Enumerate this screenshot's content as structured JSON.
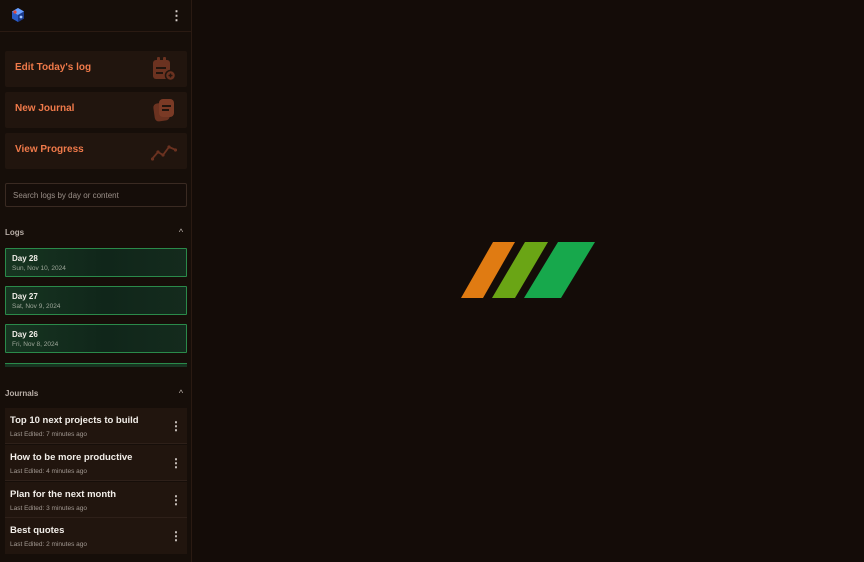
{
  "sidebar": {
    "actions": [
      {
        "label": "Edit Today's log",
        "icon": "calendar-edit-icon"
      },
      {
        "label": "New Journal",
        "icon": "notebook-icon"
      },
      {
        "label": "View Progress",
        "icon": "trend-line-icon"
      }
    ],
    "search": {
      "placeholder": "Search logs by day or content"
    },
    "logs_section": {
      "title": "Logs"
    },
    "logs": [
      {
        "day": "Day 28",
        "date": "Sun, Nov 10, 2024"
      },
      {
        "day": "Day 27",
        "date": "Sat, Nov 9, 2024"
      },
      {
        "day": "Day 26",
        "date": "Fri, Nov 8, 2024"
      }
    ],
    "journals_section": {
      "title": "Journals"
    },
    "journals": [
      {
        "title": "Top 10 next projects to build",
        "edited": "Last Edited: 7 minutes ago"
      },
      {
        "title": "How to be more productive",
        "edited": "Last Edited: 4 minutes ago"
      },
      {
        "title": "Plan for the next month",
        "edited": "Last Edited: 3 minutes ago"
      },
      {
        "title": "Best quotes",
        "edited": "Last Edited: 2 minutes ago"
      }
    ]
  },
  "colors": {
    "accent": "#f07a4a",
    "log_border": "#2a8a4a",
    "brand_orange": "#e07b12",
    "brand_lime": "#6aa515",
    "brand_green": "#17a84c"
  }
}
